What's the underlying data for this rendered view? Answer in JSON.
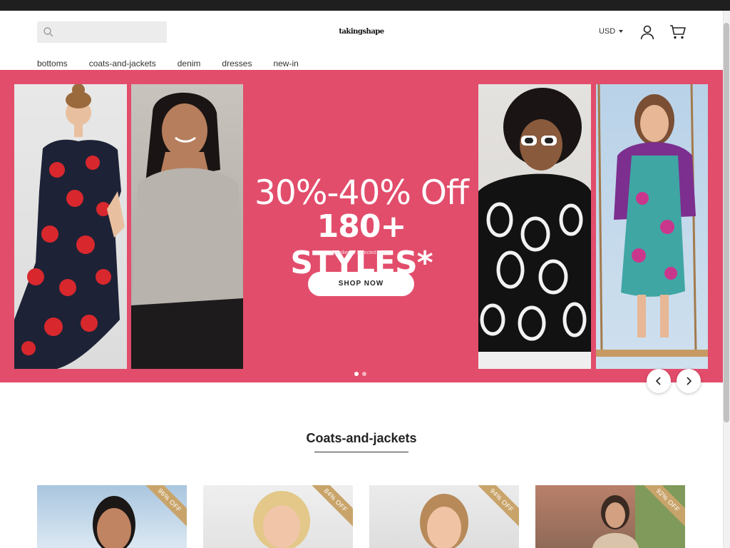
{
  "header": {
    "search": {
      "placeholder": ""
    },
    "logo_text": "takingshape",
    "currency": "USD"
  },
  "nav": {
    "items": [
      {
        "label": "bottoms"
      },
      {
        "label": "coats-and-jackets"
      },
      {
        "label": "denim"
      },
      {
        "label": "dresses"
      },
      {
        "label": "new-in"
      }
    ]
  },
  "hero": {
    "headline_1": "30%-40% Off",
    "headline_2": "180+ STYLES*",
    "note": "*Applies to Selected Styles",
    "cta_label": "SHOP NOW",
    "slide_count": 2,
    "active_slide": 1,
    "background_color": "#e24d6b"
  },
  "section": {
    "title": "Coats-and-jackets"
  },
  "products": [
    {
      "badge": "96% OFF"
    },
    {
      "badge": "84% OFF"
    },
    {
      "badge": "94% OFF"
    },
    {
      "badge": "92% OFF"
    }
  ],
  "icons": {
    "search": "search-icon",
    "account": "user-icon",
    "cart": "cart-icon",
    "prev": "chevron-left-icon",
    "next": "chevron-right-icon"
  }
}
